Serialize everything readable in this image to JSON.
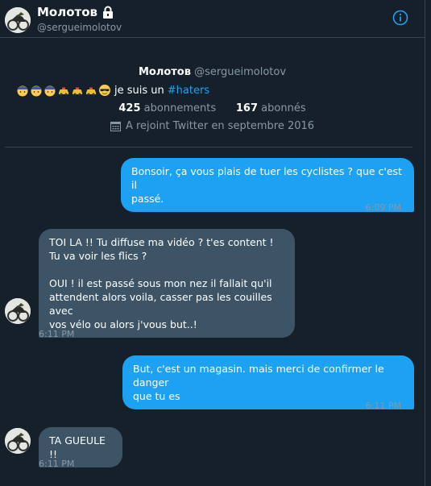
{
  "header": {
    "name": "Молотов",
    "handle": "@sergueimolotov"
  },
  "profile": {
    "name": "Молотов",
    "handle": "@sergueimolotov",
    "bio_text": "je suis un",
    "bio_hashtag": "#haters",
    "following_count": "425",
    "following_label": "abonnements",
    "followers_count": "167",
    "followers_label": "abonnés",
    "joined": "A rejoint Twitter en septembre 2016"
  },
  "messages": [
    {
      "from": "me",
      "lines": [
        "Bonsoir, ça vous plais de tuer les cyclistes ? que c'est il",
        "passé."
      ],
      "time": "6:09 PM"
    },
    {
      "from": "them",
      "lines": [
        "TOI LA !! Tu diffuse ma vidéo ? t'es content !",
        "Tu va voir les flics ?",
        "",
        "OUI ! il est passé sous mon nez il fallait qu'il",
        "attendent alors voila, casser pas les couilles avec",
        "vos vélo ou alors j'vous but..!"
      ],
      "time": "6:11 PM"
    },
    {
      "from": "me",
      "lines": [
        "But, c'est un magasin. mais merci de confirmer le danger",
        "que tu es"
      ],
      "time": "6:11 PM"
    },
    {
      "from": "them",
      "lines": [
        "TA GUEULE !!"
      ],
      "time": "6:11 PM"
    }
  ],
  "colors": {
    "background": "#15202b",
    "accent": "#1da1f2",
    "received_bubble": "#3d5466",
    "muted": "#8899a6"
  }
}
